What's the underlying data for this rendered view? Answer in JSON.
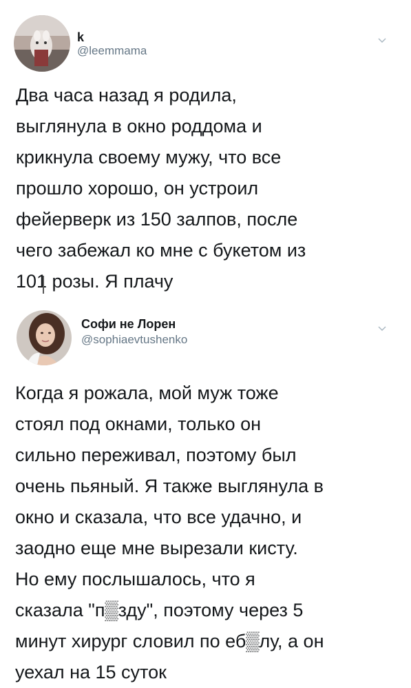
{
  "tweets": [
    {
      "display_name": "k",
      "handle": "@leemmama",
      "text": "Два часа назад я родила,\nвыглянула в окно роддома и\nкрикнула своему мужу, что все\nпрошло хорошо, он устроил\nфейерверк из 150 залпов, после\nчего забежал ко мне с букетом из\n101 розы. Я плачу"
    },
    {
      "display_name": "Софи не Лорен",
      "handle": "@sophiaevtushenko",
      "text": "Когда я рожала, мой муж тоже\nстоял под окнами, только он\nсильно переживал, поэтому был\nочень пьяный. Я также выглянула в\nокно и сказала, что все удачно, и\nзаодно еще мне вырезали кисту.\nНо ему послышалось, что я\nсказала \"п▒зду\", поэтому через 5\nминут хирург словил по еб▒лу, а он\nуехал на 15 суток"
    }
  ],
  "icons": {
    "chevron": "chevron-down-icon"
  },
  "colors": {
    "text": "#14171a",
    "secondary": "#657786",
    "chevron": "#aab8c2"
  }
}
